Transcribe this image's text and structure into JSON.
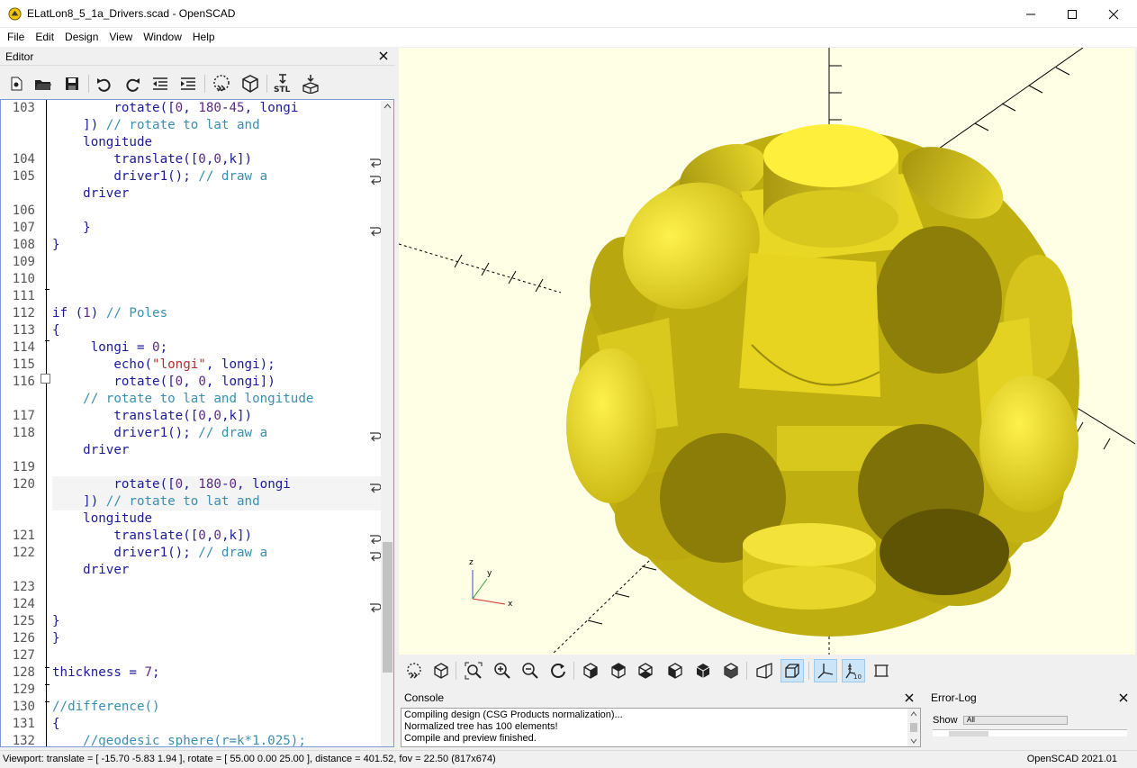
{
  "window": {
    "title": "ELatLon8_5_1a_Drivers.scad - OpenSCAD"
  },
  "menu": [
    "File",
    "Edit",
    "Design",
    "View",
    "Window",
    "Help"
  ],
  "editor": {
    "title": "Editor",
    "line_numbers": [
      "103",
      "",
      "",
      "104",
      "105",
      "",
      "106",
      "107",
      "108",
      "109",
      "110",
      "111",
      "112",
      "113",
      "114",
      "115",
      "116",
      "",
      "117",
      "118",
      "",
      "119",
      "120",
      "",
      "",
      "121",
      "122",
      "",
      "123",
      "124",
      "125",
      "126",
      "127",
      "128",
      "129",
      "130",
      "131",
      "132"
    ],
    "lines": [
      "        rotate([0, 180-45, longi",
      "    ]) // rotate to lat and",
      "    longitude",
      "        translate([0,0,k])",
      "        driver1(); // draw a",
      "    driver",
      "",
      "    }",
      "}",
      "",
      "",
      "",
      "if (1) // Poles",
      "{",
      "     longi = 0;",
      "        echo(\"longi\", longi);",
      "        rotate([0, 0, longi])",
      "    // rotate to lat and longitude",
      "        translate([0,0,k])",
      "        driver1(); // draw a",
      "    driver",
      "",
      "        rotate([0, 180-0, longi",
      "    ]) // rotate to lat and",
      "    longitude",
      "        translate([0,0,k])",
      "        driver1(); // draw a",
      "    driver",
      "",
      "",
      "}",
      "}",
      "",
      "thickness = 7;",
      "",
      "//difference()",
      "{",
      "    //geodesic_sphere(r=k*1.025);"
    ]
  },
  "console": {
    "title": "Console",
    "messages": [
      "Compiling design (CSG Products normalization)...",
      "Normalized tree has 100 elements!",
      "Compile and preview finished."
    ]
  },
  "error_log": {
    "title": "Error-Log",
    "show_label": "Show",
    "show_value": "All"
  },
  "status": {
    "viewport": "Viewport: translate = [ -15.70 -5.83 1.94 ], rotate = [ 55.00 0.00 25.00 ], distance = 401.52, fov = 22.50 (817x674)",
    "version": "OpenSCAD 2021.01"
  },
  "colors": {
    "model": "#f2e53a",
    "background": "#ffffe5",
    "accent": "#0078d7"
  },
  "axis_labels": {
    "x": "x",
    "y": "y",
    "z": "z"
  }
}
